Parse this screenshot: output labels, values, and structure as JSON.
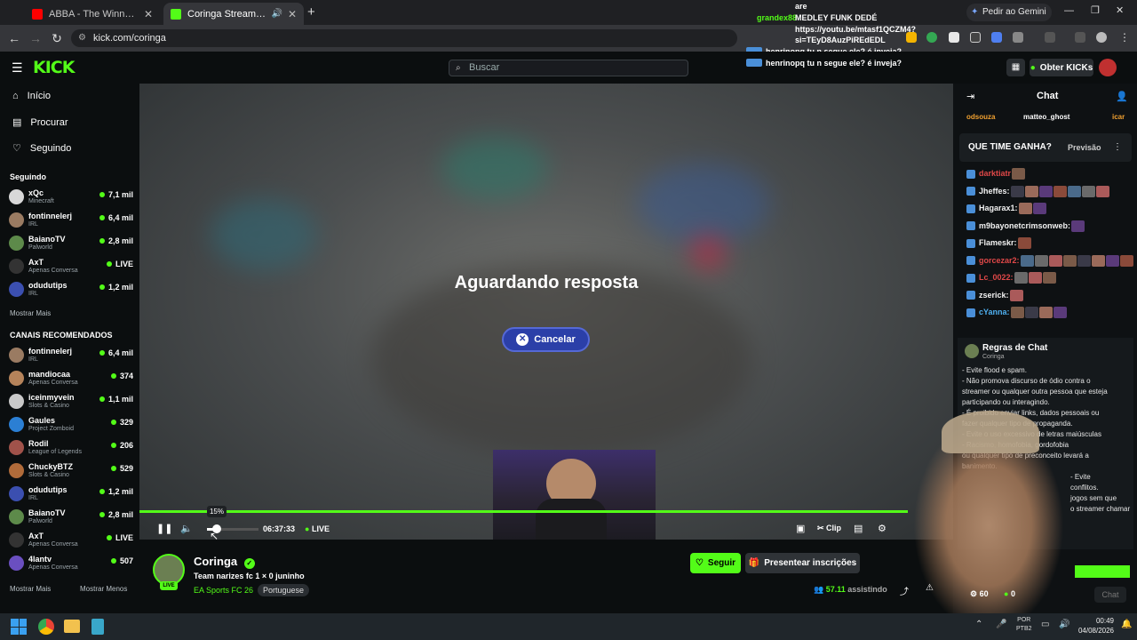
{
  "browser": {
    "tabs": [
      {
        "title": "ABBA - The Winner Takes It All",
        "close": "✕"
      },
      {
        "title": "Coringa Stream - Watch Live",
        "close": "✕"
      }
    ],
    "new_tab": "+",
    "url": "kick.com/coringa",
    "gemini": "Pedir ao Gemini"
  },
  "overlay_chat": [
    {
      "user": "are",
      "text": ""
    },
    {
      "user": "grandex88",
      "text": "MEDLEY FUNK DEDÉ"
    },
    {
      "user": "",
      "text": "https://youtu.be/mtasf1QCZM4?"
    },
    {
      "user": "",
      "text": "si=TEyD8AuzPiREdEDL"
    },
    {
      "user": "henrino",
      "text": "pq tu n segue ele? é inveja?"
    },
    {
      "user": "henrino",
      "text": "pq tu n segue ele? é inveja?"
    }
  ],
  "header": {
    "logo": "KICK",
    "search_placeholder": "Buscar",
    "get_kicks": "Obter KICKs"
  },
  "sidebar": {
    "nav": [
      {
        "label": "Início"
      },
      {
        "label": "Procurar"
      },
      {
        "label": "Seguindo"
      }
    ],
    "following_title": "Seguindo",
    "following": [
      {
        "name": "xQc",
        "game": "Minecraft",
        "viewers": "7,1 mil",
        "color": "#d8d8d8"
      },
      {
        "name": "fontinnelerj",
        "game": "IRL",
        "viewers": "6,4 mil",
        "color": "#9a7b62"
      },
      {
        "name": "BaianoTV",
        "game": "Palworld",
        "viewers": "2,8 mil",
        "color": "#5d8a4a"
      },
      {
        "name": "AxT",
        "game": "Apenas Conversa",
        "viewers": "LIVE",
        "color": "#333333"
      },
      {
        "name": "odudutips",
        "game": "IRL",
        "viewers": "1,2 mil",
        "color": "#3b4fb0"
      }
    ],
    "show_more": "Mostrar Mais",
    "recommended_title": "CANAIS RECOMENDADOS",
    "recommended": [
      {
        "name": "fontinnelerj",
        "game": "IRL",
        "viewers": "6,4 mil",
        "color": "#9a7b62"
      },
      {
        "name": "mandiocaa",
        "game": "Apenas Conversa",
        "viewers": "374",
        "color": "#b5835a"
      },
      {
        "name": "iceinmyvein",
        "game": "Slots & Casino",
        "viewers": "1,1 mil",
        "color": "#c9c9c9"
      },
      {
        "name": "Gaules",
        "game": "Project Zomboid",
        "viewers": "329",
        "color": "#2b7fd4"
      },
      {
        "name": "Rodil",
        "game": "League of Legends",
        "viewers": "206",
        "color": "#a0524a"
      },
      {
        "name": "ChuckyBTZ",
        "game": "Slots & Casino",
        "viewers": "529",
        "color": "#b06b3a"
      },
      {
        "name": "odudutips",
        "game": "IRL",
        "viewers": "1,2 mil",
        "color": "#3b4fb0"
      },
      {
        "name": "BaianoTV",
        "game": "Palworld",
        "viewers": "2,8 mil",
        "color": "#5d8a4a"
      },
      {
        "name": "AxT",
        "game": "Apenas Conversa",
        "viewers": "LIVE",
        "color": "#333333"
      },
      {
        "name": "4lantv",
        "game": "Apenas Conversa",
        "viewers": "507",
        "color": "#6a4fc0"
      }
    ],
    "show_more_2": "Mostrar Mais",
    "show_less": "Mostrar Menos"
  },
  "player": {
    "status": "Aguardando resposta",
    "cancel": "Cancelar",
    "volume_tip": "15%",
    "volume_level": 0.15,
    "time": "06:37:33",
    "live": "LIVE",
    "clip": "Clip"
  },
  "channel": {
    "name": "Coringa",
    "live_badge": "LIVE",
    "title": "Team narizes fc 1 × 0 juninho",
    "category": "EA Sports FC 26",
    "tag": "Portuguese",
    "follow": "Seguir",
    "gift": "Presentear inscrições",
    "watching_count": "57.11",
    "watching_label": "assistindo"
  },
  "chat": {
    "title": "Chat",
    "top_users": [
      "odsouza",
      "matteo_ghost",
      "icar"
    ],
    "prediction_title": "QUE TIME GANHA?",
    "prediction_label": "Previsão",
    "messages": [
      {
        "user": "darktiatr",
        "color": "#e04848",
        "emotes": 1
      },
      {
        "user": "Jheffes:",
        "color": "#f2f2f2",
        "emotes": 7
      },
      {
        "user": "Hagarax1:",
        "color": "#f2f2f2",
        "emotes": 2
      },
      {
        "user": "m9bayonetcrimsonweb:",
        "color": "#f2f2f2",
        "emotes": 1
      },
      {
        "user": "Flameskr:",
        "color": "#f2f2f2",
        "emotes": 1
      },
      {
        "user": "gorcezar2:",
        "color": "#e04848",
        "emotes": 8
      },
      {
        "user": "Lc_0022:",
        "color": "#e04848",
        "emotes": 3
      },
      {
        "user": "zserick:",
        "color": "#f2f2f2",
        "emotes": 1
      },
      {
        "user": "cYanna:",
        "color": "#4fb0f0",
        "emotes": 4
      }
    ],
    "rules_title": "Regras de Chat",
    "rules_owner": "Coringa",
    "rules": [
      "- Evite flood e spam.",
      "- Não promova discurso de ódio contra o",
      "streamer ou qualquer outra pessoa que esteja",
      "participando ou interagindo.",
      "- É proibido enviar links, dados pessoais ou",
      "fazer qualquer tipo de propaganda.",
      "- Evite o uso excessivo de letras maiúsculas",
      "- Racismo, homofobia, gordofobia",
      "ou qualquer tipo de preconceito levará a",
      "banimento.",
      "- Evite",
      "conflitos.",
      "jogos sem que",
      "o streamer chamar"
    ],
    "bits": "60",
    "kicks": "0",
    "chat_button": "Chat"
  },
  "taskbar": {
    "lang1": "POR",
    "lang2": "PTB2",
    "time": "00:49",
    "date": "04/08/2026"
  },
  "colors": {
    "accent": "#53fc18",
    "cancel": "#2b3fa8"
  }
}
